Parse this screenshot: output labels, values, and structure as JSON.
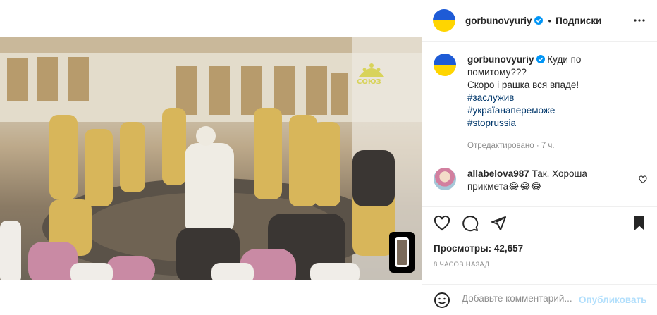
{
  "header": {
    "username": "gorbunovyuriy",
    "separator": "•",
    "follow_label": "Подписки",
    "more_icon": "more-horizontal-icon"
  },
  "caption": {
    "username": "gorbunovyuriy",
    "text_line1": "Куди по",
    "text_line2": "помитому???",
    "text_line3": "Скоро і рашка вся впаде!",
    "hashtags": [
      "#заслужив",
      "#україанапереможе",
      "#stoprussia"
    ],
    "edited": "Отредактировано · 7 ч."
  },
  "comment": {
    "username": "allabelova987",
    "text": "Так. Хороша прикмета😂😂😂"
  },
  "actions": {
    "like_icon": "heart-icon",
    "comment_icon": "comment-icon",
    "share_icon": "send-icon",
    "save_icon": "bookmark-icon"
  },
  "stats": {
    "views": "Просмотры: 42,657",
    "time": "8 ЧАСОВ НАЗАД"
  },
  "comment_box": {
    "placeholder": "Добавьте комментарий...",
    "publish_label": "Опубликовать"
  },
  "video": {
    "watermark": "СОЮЗ"
  },
  "colors": {
    "flag_blue": "#1e5bd6",
    "flag_yellow": "#ffd500",
    "link": "#00376b",
    "verified": "#0095f6",
    "publish_disabled": "#b2dffc"
  }
}
